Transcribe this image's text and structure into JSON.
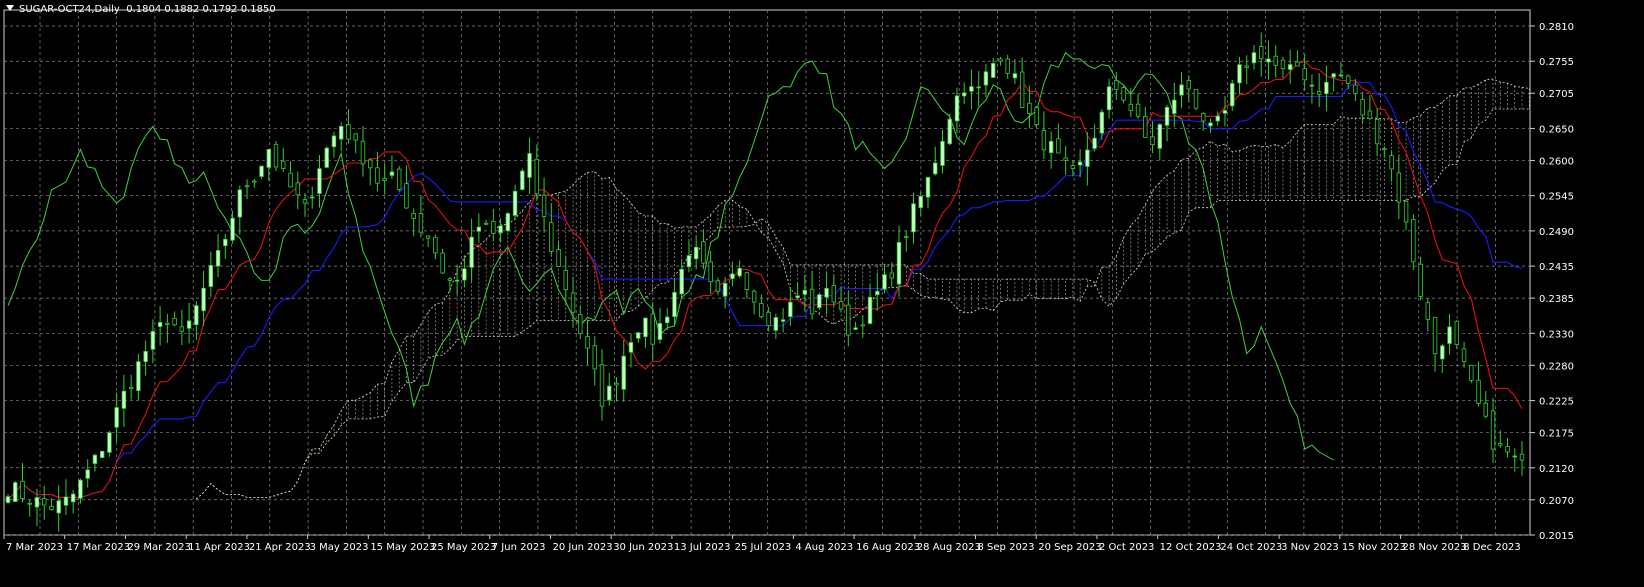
{
  "header": {
    "symbol": "SUGAR-OCT24,Daily",
    "ohlc": "0.1804 0.1882 0.1792 0.1850"
  },
  "colors": {
    "background": "#000000",
    "grid": "#8a8a8a",
    "bull_body": "#c8ffc8",
    "bear_body": "#000000",
    "wick": "#2fd12f",
    "tenkan": "#e01010",
    "kijun": "#1a1aff",
    "chikou": "#3fd13f",
    "cloud": "#e8d8c0"
  },
  "chart_data": {
    "type": "candlestick",
    "indicator": "Ichimoku",
    "ylim": [
      0.2015,
      0.2835
    ],
    "y_ticks": [
      "0.2810",
      "0.2755",
      "0.2705",
      "0.2650",
      "0.2600",
      "0.2545",
      "0.2490",
      "0.2435",
      "0.2385",
      "0.2330",
      "0.2280",
      "0.2225",
      "0.2175",
      "0.2120",
      "0.2070",
      "0.2015"
    ],
    "x_ticks": [
      "7 Mar 2023",
      "17 Mar 2023",
      "29 Mar 2023",
      "11 Apr 2023",
      "21 Apr 2023",
      "3 May 2023",
      "15 May 2023",
      "25 May 2023",
      "7 Jun 2023",
      "20 Jun 2023",
      "30 Jun 2023",
      "13 Jul 2023",
      "25 Jul 2023",
      "4 Aug 2023",
      "16 Aug 2023",
      "28 Aug 2023",
      "8 Sep 2023",
      "20 Sep 2023",
      "2 Oct 2023",
      "12 Oct 2023",
      "24 Oct 2023",
      "3 Nov 2023",
      "15 Nov 2023",
      "28 Nov 2023",
      "8 Dec 2023"
    ],
    "close_path": [
      0.209,
      0.208,
      0.207,
      0.206,
      0.206,
      0.207,
      0.21,
      0.213,
      0.217,
      0.222,
      0.226,
      0.23,
      0.233,
      0.236,
      0.232,
      0.236,
      0.241,
      0.245,
      0.251,
      0.256,
      0.258,
      0.262,
      0.258,
      0.255,
      0.252,
      0.259,
      0.263,
      0.266,
      0.262,
      0.26,
      0.256,
      0.257,
      0.254,
      0.25,
      0.248,
      0.243,
      0.24,
      0.245,
      0.25,
      0.248,
      0.25,
      0.256,
      0.26,
      0.252,
      0.245,
      0.24,
      0.234,
      0.228,
      0.222,
      0.226,
      0.232,
      0.235,
      0.232,
      0.236,
      0.241,
      0.247,
      0.243,
      0.238,
      0.24,
      0.244,
      0.239,
      0.236,
      0.235,
      0.237,
      0.24,
      0.236,
      0.241,
      0.236,
      0.233,
      0.236,
      0.239,
      0.242,
      0.247,
      0.252,
      0.256,
      0.262,
      0.268,
      0.272,
      0.27,
      0.274,
      0.277,
      0.273,
      0.268,
      0.264,
      0.262,
      0.259,
      0.257,
      0.262,
      0.266,
      0.272,
      0.27,
      0.266,
      0.262,
      0.266,
      0.27,
      0.272,
      0.268,
      0.264,
      0.267,
      0.273,
      0.276,
      0.277,
      0.275,
      0.273,
      0.275,
      0.272,
      0.271,
      0.274,
      0.272,
      0.268,
      0.265,
      0.262,
      0.255,
      0.247,
      0.238,
      0.23,
      0.234,
      0.229,
      0.224,
      0.219,
      0.215,
      0.214,
      0.212
    ]
  }
}
